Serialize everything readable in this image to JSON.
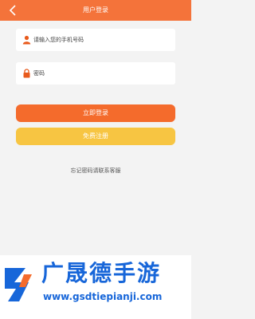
{
  "header": {
    "title": "用户登录",
    "back_icon": "chevron-left-icon"
  },
  "form": {
    "phone_placeholder": "请输入您的手机号码",
    "phone_icon": "user-icon",
    "password_placeholder": "密码",
    "password_icon": "lock-icon"
  },
  "buttons": {
    "login": "立即登录",
    "register": "免费注册"
  },
  "forgot_text": "忘记密码请联系客服",
  "watermark": {
    "title": "广晟德手游",
    "url": "www.gsdtiepianji.com"
  },
  "colors": {
    "header": "#f4733a",
    "login": "#f46b2c",
    "register": "#f7c542",
    "watermark": "#1766d9"
  }
}
